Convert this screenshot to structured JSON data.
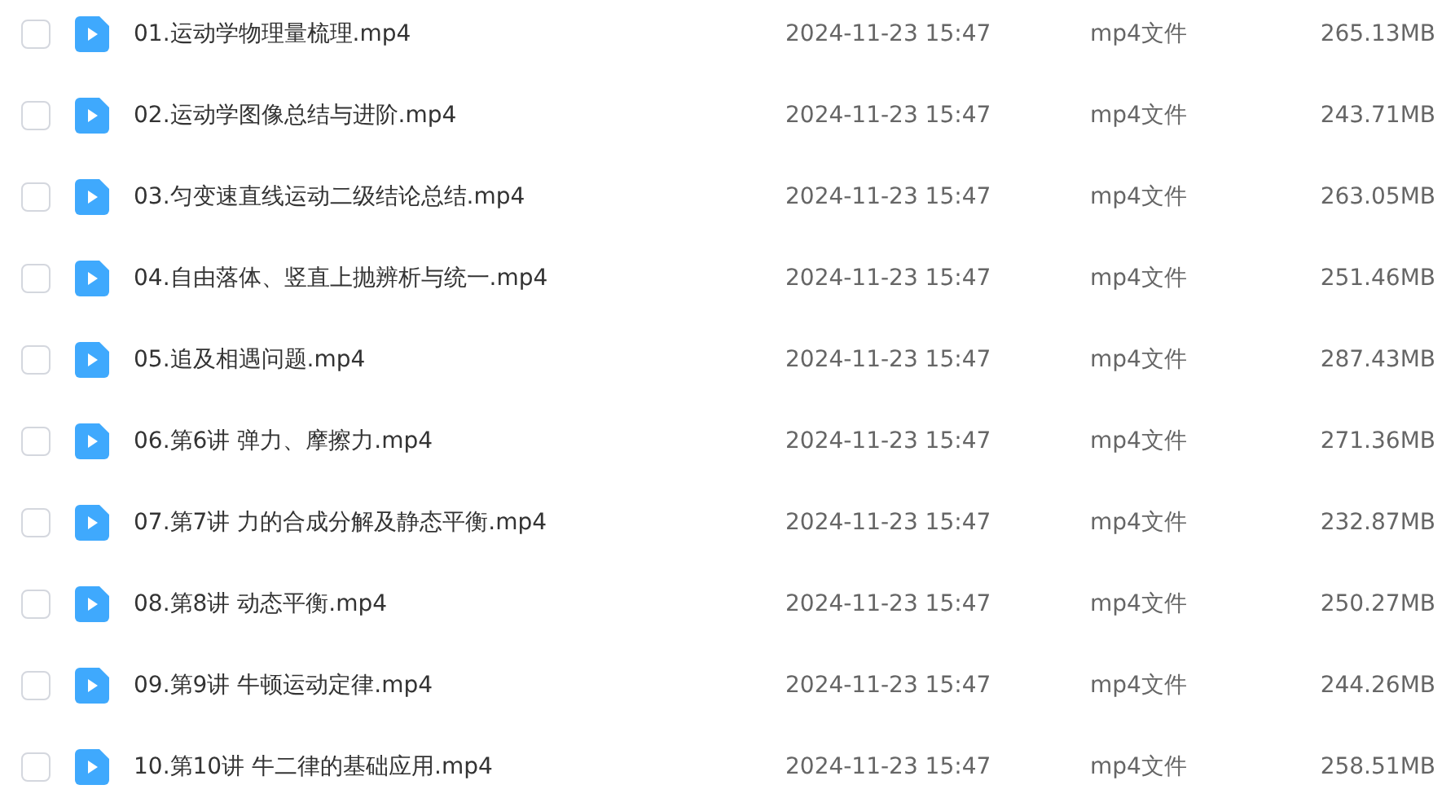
{
  "files": [
    {
      "name": "01.运动学物理量梳理.mp4",
      "date": "2024-11-23 15:47",
      "type": "mp4文件",
      "size": "265.13MB",
      "checked": false
    },
    {
      "name": "02.运动学图像总结与进阶.mp4",
      "date": "2024-11-23 15:47",
      "type": "mp4文件",
      "size": "243.71MB",
      "checked": false
    },
    {
      "name": "03.匀变速直线运动二级结论总结.mp4",
      "date": "2024-11-23 15:47",
      "type": "mp4文件",
      "size": "263.05MB",
      "checked": false
    },
    {
      "name": "04.自由落体、竖直上抛辨析与统一.mp4",
      "date": "2024-11-23 15:47",
      "type": "mp4文件",
      "size": "251.46MB",
      "checked": false
    },
    {
      "name": "05.追及相遇问题.mp4",
      "date": "2024-11-23 15:47",
      "type": "mp4文件",
      "size": "287.43MB",
      "checked": false
    },
    {
      "name": "06.第6讲 弹力、摩擦力.mp4",
      "date": "2024-11-23 15:47",
      "type": "mp4文件",
      "size": "271.36MB",
      "checked": false
    },
    {
      "name": "07.第7讲 力的合成分解及静态平衡.mp4",
      "date": "2024-11-23 15:47",
      "type": "mp4文件",
      "size": "232.87MB",
      "checked": false
    },
    {
      "name": "08.第8讲 动态平衡.mp4",
      "date": "2024-11-23 15:47",
      "type": "mp4文件",
      "size": "250.27MB",
      "checked": false
    },
    {
      "name": "09.第9讲 牛顿运动定律.mp4",
      "date": "2024-11-23 15:47",
      "type": "mp4文件",
      "size": "244.26MB",
      "checked": false
    },
    {
      "name": "10.第10讲 牛二律的基础应用.mp4",
      "date": "2024-11-23 15:47",
      "type": "mp4文件",
      "size": "258.51MB",
      "checked": false
    }
  ]
}
